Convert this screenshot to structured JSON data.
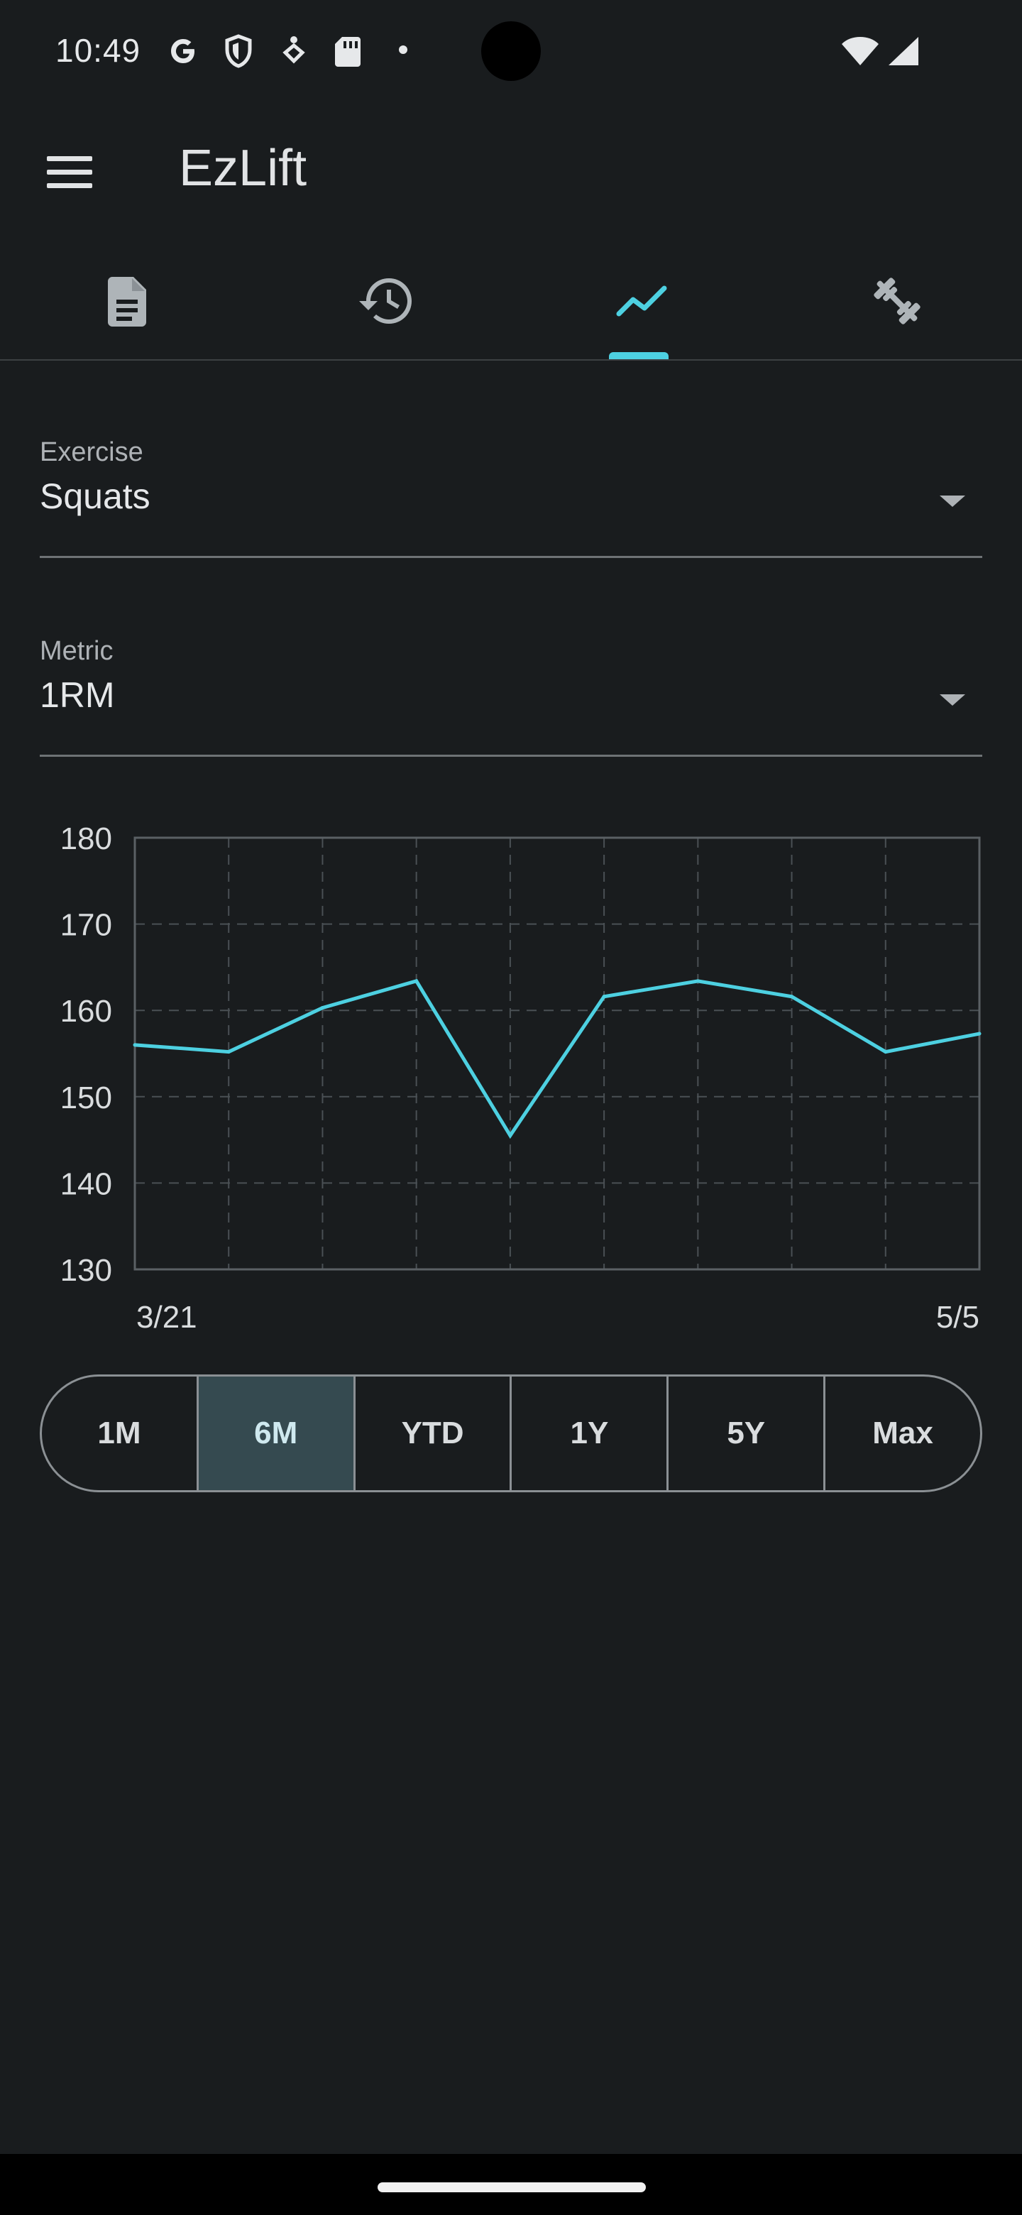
{
  "status_bar": {
    "time": "10:49",
    "icons": [
      "google-icon",
      "shield-icon",
      "fitness-icon",
      "sd-card-icon",
      "dot-icon",
      "wifi-icon",
      "signal-icon"
    ]
  },
  "app_bar": {
    "title": "EzLift",
    "menu_icon": "hamburger-menu-icon"
  },
  "tabs": [
    {
      "icon": "document-icon",
      "selected": false
    },
    {
      "icon": "history-icon",
      "selected": false
    },
    {
      "icon": "trending-icon",
      "selected": true
    },
    {
      "icon": "dumbbell-icon",
      "selected": false
    }
  ],
  "exercise_field": {
    "label": "Exercise",
    "value": "Squats"
  },
  "metric_field": {
    "label": "Metric",
    "value": "1RM"
  },
  "colors": {
    "background": "#191c1e",
    "accent": "#4dd0e1",
    "selected_segment": "#354a50"
  },
  "chart_data": {
    "type": "line",
    "title": "",
    "xlabel": "",
    "ylabel": "",
    "ylim": [
      130,
      180
    ],
    "yticks": [
      180,
      170,
      160,
      150,
      140,
      130
    ],
    "x_tick_labels": [
      "3/21",
      "5/5"
    ],
    "grid": true,
    "series": [
      {
        "values": [
          156,
          155.2,
          160.3,
          163.4,
          145.5,
          161.6,
          163.4,
          161.6,
          155.2,
          157.3
        ]
      }
    ]
  },
  "range_selector": {
    "options": [
      "1M",
      "6M",
      "YTD",
      "1Y",
      "5Y",
      "Max"
    ],
    "selected": "6M"
  }
}
